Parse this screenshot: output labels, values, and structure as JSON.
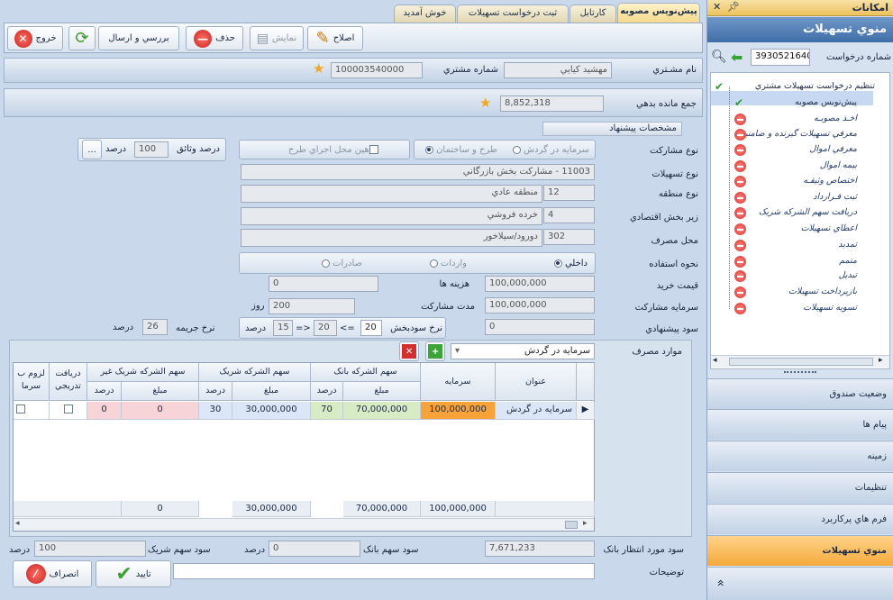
{
  "tabs": [
    {
      "label": "پيش‌نويس مصوبه"
    },
    {
      "label": "کارتابل"
    },
    {
      "label": "ثبت درخواست تسهيلات"
    },
    {
      "label": "خوش آمديد"
    }
  ],
  "toolbar": {
    "edit": "اصلاح",
    "show": "نمايش",
    "delete": "حذف",
    "review": "بررسي و ارسال",
    "exit": "خروج"
  },
  "customer": {
    "name_label": "نام مشـتري",
    "name_value": "مهشيد کيايي",
    "number_label": "شماره مشتري",
    "number_value": "100003540000"
  },
  "debt": {
    "label": "جمع مانده بدهي",
    "value": "8,852,318"
  },
  "section_title": "مشخصات پيشنهاد",
  "participation": {
    "label": "نوع مشارکت",
    "opt1": "سرمايه در گردش",
    "opt2": "طرح و ساختمان",
    "check_label": "ترهين محل اجراي طرح",
    "collateral_label": "درصد وثائق",
    "collateral_value": "100",
    "percent": "درصد",
    "more": "..."
  },
  "facility_type": {
    "label": "نوع تسهيلات",
    "value": "11003 - مشارکت بخش بازرگاني"
  },
  "zone": {
    "label": "نوع منطقه",
    "code": "12",
    "value": "منطقه عادي"
  },
  "sector": {
    "label": "زير بخش اقتصادي",
    "code": "4",
    "value": "خرده فروشي"
  },
  "usage_place": {
    "label": "محل مصرف",
    "code": "302",
    "value": "دورود/سيلاخور"
  },
  "usage_method": {
    "label": "نحوه استفاده",
    "opt1": "داخلي",
    "opt2": "واردات",
    "opt3": "صادرات"
  },
  "purchase_price": {
    "label": "قيمت خريد",
    "value": "100,000,000"
  },
  "costs": {
    "label": "هزينه ها",
    "value": "0"
  },
  "participation_capital": {
    "label": "سرمايه مشارکت",
    "value": "100,000,000"
  },
  "duration": {
    "label": "مدت مشارکت",
    "value": "200",
    "unit": "روز"
  },
  "proposed_profit": {
    "label": "سود پيشنهادي",
    "value": "0"
  },
  "profit_rate": {
    "label": "نرخ سودبخش",
    "v1": "20",
    "op1": "<=",
    "v2": "20",
    "op2": "=>",
    "v3": "15",
    "unit": "درصد"
  },
  "penalty": {
    "label": "نرخ جريمه",
    "value": "26",
    "unit": "درصد"
  },
  "usage_items": {
    "label": "موارد مصرف",
    "selected": "سرمايه در گردش"
  },
  "grid": {
    "headers": {
      "title": "عنوان",
      "capital": "سرمايه",
      "bank_share": "سهم الشرکه بانک",
      "partner_share": "سهم الشرکه شريک",
      "non_cash": "سهم الشرکه شريک غير",
      "gradual": "دريافت تدريجي",
      "need": "لزوم ب",
      "need2": "سرما",
      "gradual2": "",
      "amount": "مبلغ",
      "percent": "درصد"
    },
    "row": {
      "title": "سرمايه در گردش",
      "capital": "100,000,000",
      "bank_amount": "70,000,000",
      "bank_percent": "70",
      "partner_amount": "30,000,000",
      "partner_percent": "30",
      "nc_amount": "0",
      "nc_percent": "0"
    },
    "totals": {
      "capital": "100,000,000",
      "bank": "70,000,000",
      "partner": "30,000,000",
      "nc": "0"
    }
  },
  "expected_profit": {
    "label": "سود مورد انتظار بانک",
    "value": "7,671,233"
  },
  "bank_profit": {
    "label": "سود سهم بانک",
    "value": "0",
    "unit": "درصد"
  },
  "partner_profit": {
    "label": "سود سهم شريک",
    "value": "100",
    "unit": "درصد"
  },
  "notes": {
    "label": "توضيحات",
    "value": ""
  },
  "confirm": "تاييد",
  "cancel": "انصراف",
  "sidebar": {
    "header": "امکانات",
    "title": "منوي تسهيلات",
    "req_label": "شماره درخواست",
    "req_value": "3930521640",
    "items": [
      {
        "label": "تنظيم درخواست تسهيلات مشتري",
        "status": "ok"
      },
      {
        "label": "پيش‌نويس مصوبه",
        "status": "ok"
      },
      {
        "label": "اخـذ مصوبـه",
        "status": "no"
      },
      {
        "label": "معرفي تسهيلات گيرنده و ضامنين",
        "status": "no"
      },
      {
        "label": "معرفي اموال",
        "status": "no"
      },
      {
        "label": "بيمه اموال",
        "status": "no"
      },
      {
        "label": "اختصاص وثيقـه",
        "status": "no"
      },
      {
        "label": "ثبت قـرارداد",
        "status": "no"
      },
      {
        "label": "دريافت سهم الشرکه شريک",
        "status": "no"
      },
      {
        "label": "اعطاي تسهيلات",
        "status": "no"
      },
      {
        "label": "تمديد",
        "status": "no"
      },
      {
        "label": "متمم",
        "status": "no"
      },
      {
        "label": "تبديل",
        "status": "no"
      },
      {
        "label": "بازپرداخت تسهيلات",
        "status": "no"
      },
      {
        "label": "تسويه تسهيلات",
        "status": "no"
      }
    ],
    "nav": [
      {
        "label": "وضعيت صندوق"
      },
      {
        "label": "پيام ها"
      },
      {
        "label": "زمينه"
      },
      {
        "label": "تنظيمات"
      },
      {
        "label": "فرم هاي پرکاربرد"
      },
      {
        "label": "منوي تسهيلات"
      }
    ],
    "expand": "»"
  }
}
